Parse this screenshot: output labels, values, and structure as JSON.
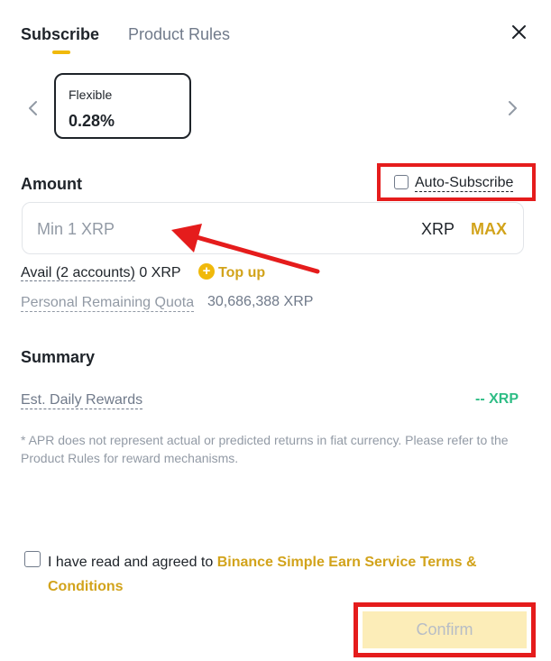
{
  "tabs": {
    "subscribe": "Subscribe",
    "product_rules": "Product Rules"
  },
  "product": {
    "label": "Flexible",
    "apr": "0.28%"
  },
  "amount": {
    "title": "Amount",
    "auto_subscribe": "Auto-Subscribe",
    "placeholder": "Min 1 XRP",
    "unit": "XRP",
    "max": "MAX",
    "avail_label": "Avail (2 accounts)",
    "avail_value": "0 XRP",
    "top_up": "Top up",
    "quota_label": "Personal Remaining Quota",
    "quota_value": "30,686,388 XRP"
  },
  "summary": {
    "title": "Summary",
    "rewards_label": "Est. Daily Rewards",
    "rewards_value": "-- XRP",
    "note": "* APR does not represent actual or predicted returns in fiat currency. Please refer to the Product Rules for reward mechanisms."
  },
  "agreement": {
    "text": "I have read and agreed to ",
    "link": "Binance Simple Earn Service Terms & Conditions"
  },
  "confirm_label": "Confirm",
  "colors": {
    "accent": "#f0b90b",
    "link": "#d2a31b",
    "positive": "#2ebd85",
    "highlight": "#e51c1c"
  },
  "icons": [
    "close-icon",
    "chevron-left-icon",
    "chevron-right-icon",
    "plus-circle-icon",
    "arrow-annotation"
  ]
}
